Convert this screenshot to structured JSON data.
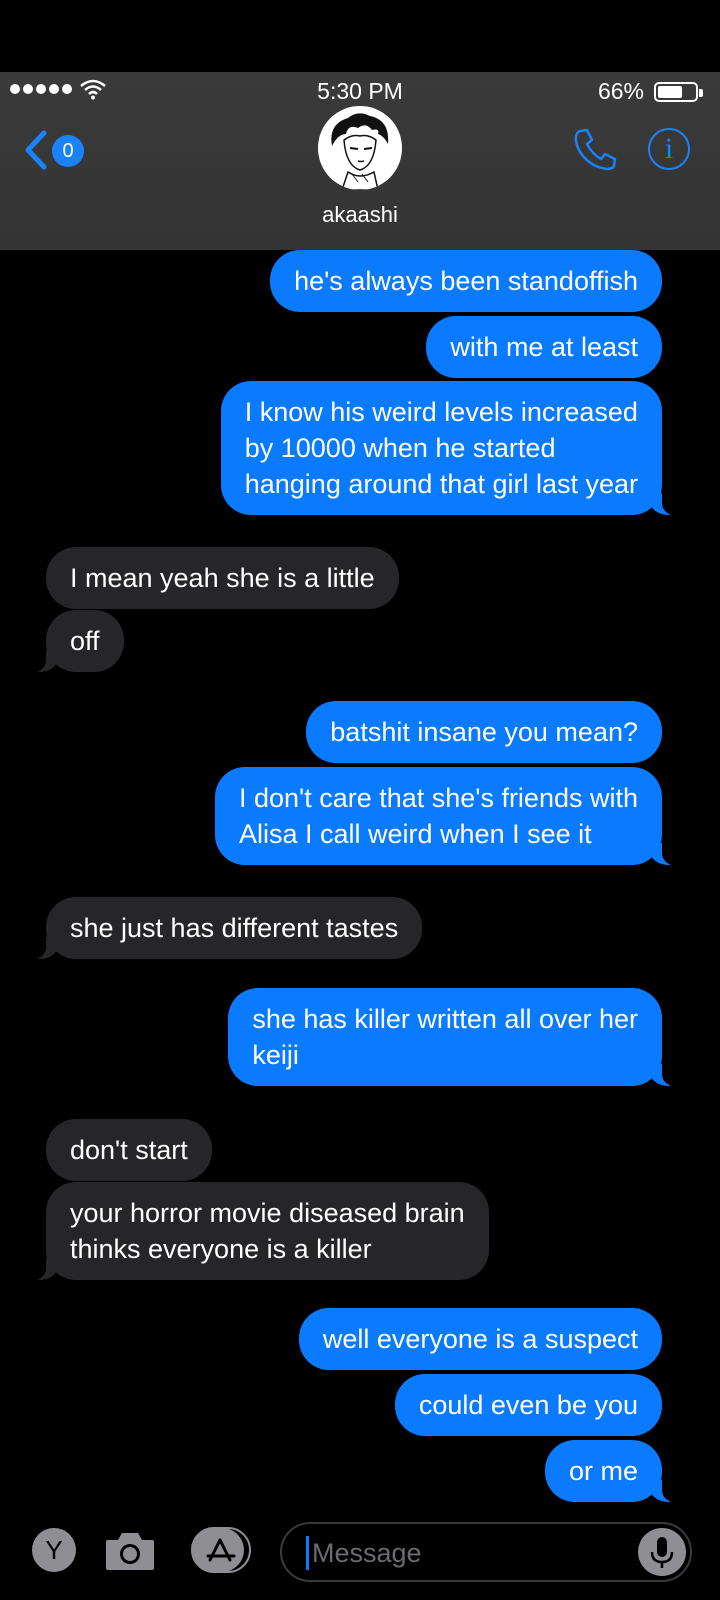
{
  "status_bar": {
    "time": "5:30 PM",
    "battery": "66%"
  },
  "header": {
    "back_count": "0",
    "contact_name": "akaashi"
  },
  "messages": [
    {
      "from": "me",
      "text": "he's always been standoffish"
    },
    {
      "from": "me",
      "text": "with me at least"
    },
    {
      "from": "me",
      "text": "I know his weird levels increased\nby 10000 when he started\nhanging around that girl last year"
    },
    {
      "from": "them",
      "text": "I mean yeah she is a little"
    },
    {
      "from": "them",
      "text": "off"
    },
    {
      "from": "me",
      "text": "batshit insane you mean?"
    },
    {
      "from": "me",
      "text": "I don't care that she's friends with\nAlisa I call weird when I see it"
    },
    {
      "from": "them",
      "text": "she just has different tastes"
    },
    {
      "from": "me",
      "text": "she has killer written all over her\nkeiji"
    },
    {
      "from": "them",
      "text": "don't start"
    },
    {
      "from": "them",
      "text": "your horror movie diseased brain\nthinks everyone is a killer"
    },
    {
      "from": "me",
      "text": "well everyone is a suspect"
    },
    {
      "from": "me",
      "text": "could even be you"
    },
    {
      "from": "me",
      "text": "or me"
    }
  ],
  "input_bar": {
    "app_letter": "Y",
    "placeholder": "Message"
  },
  "colors": {
    "sent_bubble": "#0a7afe",
    "received_bubble": "#262628",
    "accent": "#1a82fb"
  }
}
